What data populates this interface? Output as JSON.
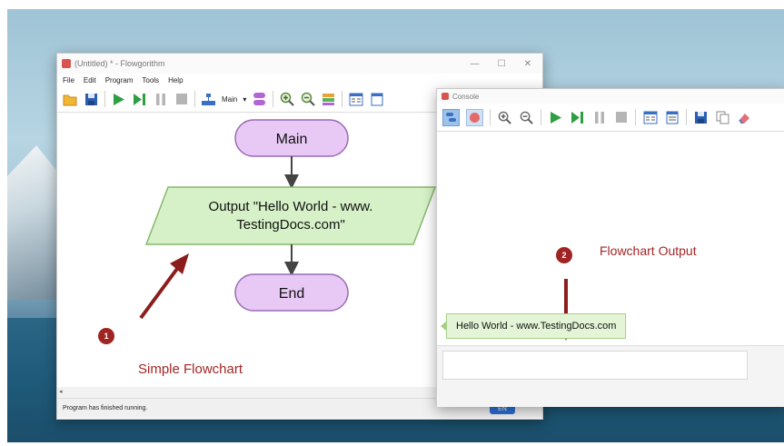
{
  "flowgorithm": {
    "title": "(Untitled) * - Flowgorithm",
    "window_controls": [
      "—",
      "☐",
      "✕"
    ],
    "menu": [
      "File",
      "Edit",
      "Program",
      "Tools",
      "Help"
    ],
    "toolbar_dropdown": "Main",
    "chart": {
      "start_label": "Main",
      "output_line1": "Output \"Hello World - www.",
      "output_line2": "TestingDocs.com\"",
      "end_label": "End"
    },
    "status_text": "Program has finished running.",
    "lang_badge": "EN",
    "scroll_marker": "◂"
  },
  "console": {
    "title": "Console",
    "output_text": "Hello World - www.TestingDocs.com"
  },
  "annotations": {
    "label1": "Simple Flowchart",
    "num1": "1",
    "label2": "Flowchart Output",
    "num2": "2"
  },
  "colors": {
    "terminal_fill": "#e8c8f5",
    "terminal_stroke": "#9b6bb5",
    "io_fill": "#d6f1c7",
    "io_stroke": "#86b86c",
    "annotation": "#a32525",
    "play_green": "#2ea043",
    "status_badge": "#2c6fd6"
  }
}
